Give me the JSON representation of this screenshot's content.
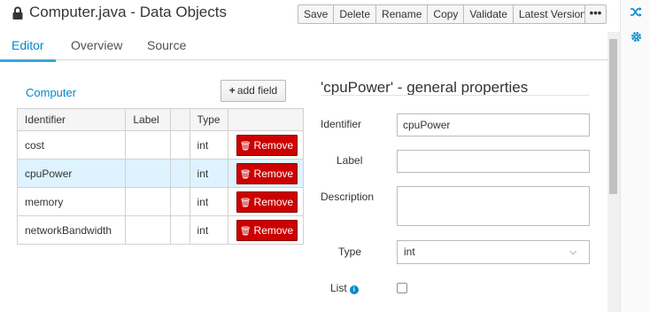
{
  "header": {
    "title": "Computer.java - Data Objects",
    "toolbar": [
      "Save",
      "Delete",
      "Rename",
      "Copy",
      "Validate"
    ],
    "version_label": "Latest Version",
    "kebab": "•••"
  },
  "rail": {
    "icons": [
      "shuffle-icon",
      "gear-icon"
    ]
  },
  "tabs": [
    {
      "label": "Editor",
      "active": true
    },
    {
      "label": "Overview",
      "active": false
    },
    {
      "label": "Source",
      "active": false
    }
  ],
  "fields": {
    "object_name": "Computer",
    "add_label": "add field",
    "columns": [
      "Identifier",
      "Label",
      "",
      "Type",
      ""
    ],
    "remove_label": "Remove",
    "rows": [
      {
        "identifier": "cost",
        "label": "",
        "type": "int",
        "selected": false
      },
      {
        "identifier": "cpuPower",
        "label": "",
        "type": "int",
        "selected": true
      },
      {
        "identifier": "memory",
        "label": "",
        "type": "int",
        "selected": false
      },
      {
        "identifier": "networkBandwidth",
        "label": "",
        "type": "int",
        "selected": false
      }
    ]
  },
  "props": {
    "title": "'cpuPower' - general properties",
    "identifier_label": "Identifier",
    "identifier_value": "cpuPower",
    "label_label": "Label",
    "label_value": "",
    "description_label": "Description",
    "description_value": "",
    "type_label": "Type",
    "type_value": "int",
    "list_label": "List",
    "list_checked": false
  },
  "colors": {
    "accent": "#0088ce",
    "danger": "#cc0000",
    "selected_row": "#def3ff"
  }
}
